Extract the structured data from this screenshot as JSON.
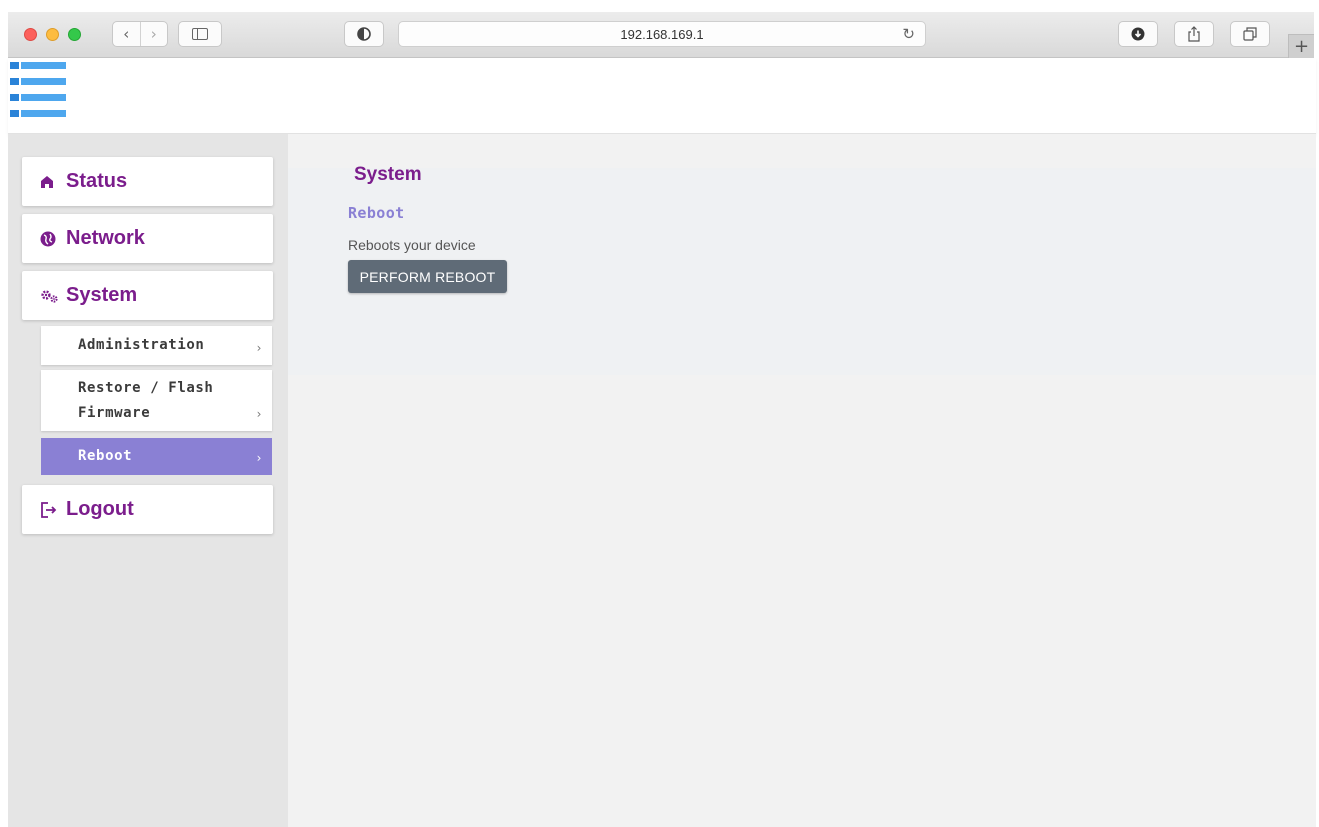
{
  "browser": {
    "address": "192.168.169.1",
    "icons": {
      "back": "chevron-left-icon",
      "forward": "chevron-right-icon",
      "sidebar": "sidebar-icon",
      "privacy": "shield-icon",
      "reload": "reload-icon",
      "download": "download-icon",
      "share": "share-icon",
      "tabs": "tabs-icon",
      "new_tab": "plus-icon"
    },
    "new_tab_label": "+"
  },
  "header": {
    "logo_icon": "logo-bars-icon"
  },
  "sidebar": {
    "items": [
      {
        "label": "Status",
        "icon": "home-icon"
      },
      {
        "label": "Network",
        "icon": "globe-icon"
      },
      {
        "label": "System",
        "icon": "gears-icon"
      },
      {
        "label": "Logout",
        "icon": "logout-icon"
      }
    ],
    "sub_items": [
      {
        "label": "Administration"
      },
      {
        "label": "Restore / Flash",
        "label2": "Firmware"
      },
      {
        "label": "Reboot",
        "active": true
      }
    ],
    "chevron": "›"
  },
  "main": {
    "title": "System",
    "subtitle": "Reboot",
    "description": "Reboots your device",
    "reboot_button": "PERFORM REBOOT"
  },
  "colors": {
    "brand_purple": "#7b1d8c",
    "active_submenu": "#8a80d4",
    "button_bg": "#5f6b77",
    "logo_blue": "#4ea7ee"
  }
}
